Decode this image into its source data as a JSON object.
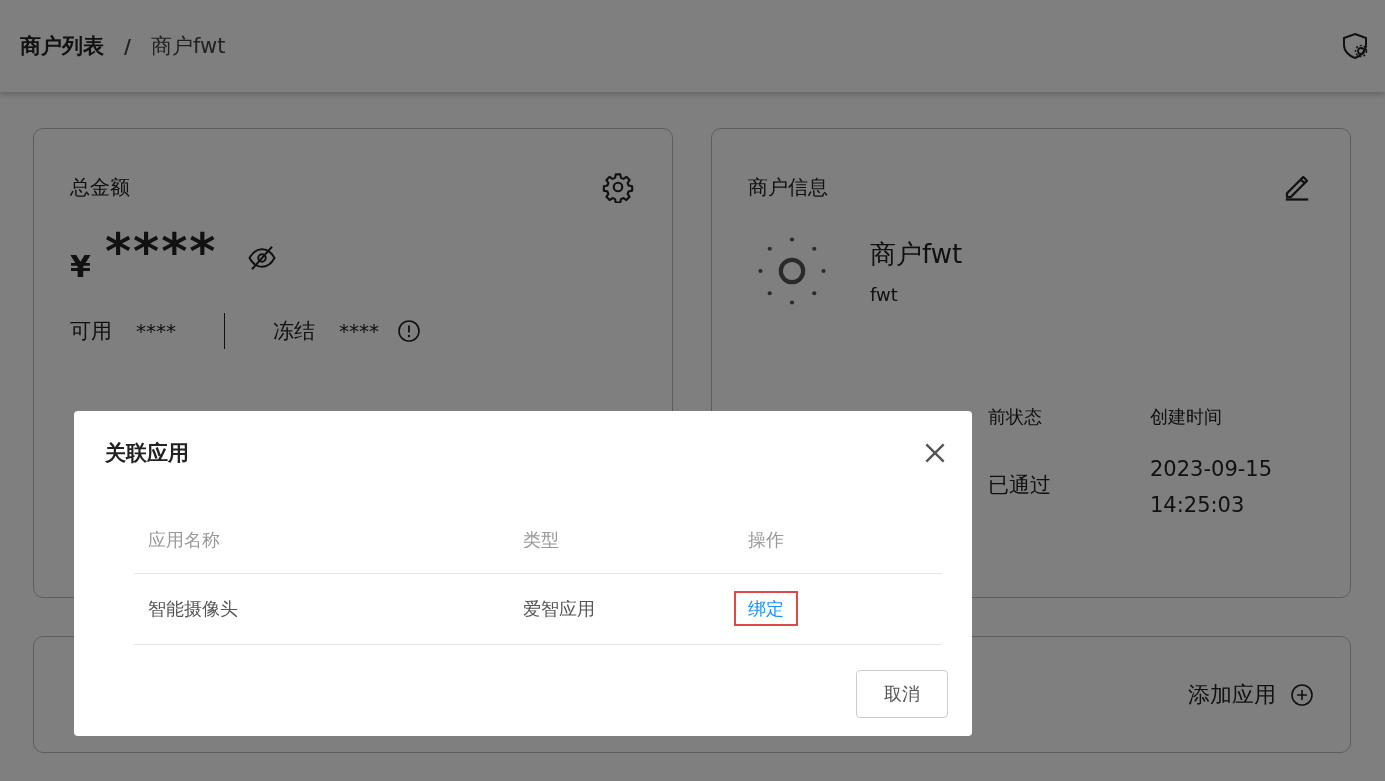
{
  "breadcrumb": {
    "items": [
      {
        "label": "商户列表",
        "current": false
      },
      {
        "label": "商户fwt",
        "current": true
      }
    ],
    "separator": "/"
  },
  "balance_card": {
    "title": "总金额",
    "currency": "¥",
    "amount": "****",
    "stats": [
      {
        "label": "可用",
        "value": "****"
      },
      {
        "label": "冻结",
        "value": "****",
        "info": true
      }
    ]
  },
  "merchant_card": {
    "title": "商户信息",
    "name": "商户fwt",
    "code": "fwt",
    "fields": [
      {
        "label": "前状态",
        "value": "已通过"
      },
      {
        "label": "创建时间",
        "value": "2023-09-15 14:25:03"
      }
    ]
  },
  "apps_card": {
    "add_label": "添加应用"
  },
  "dialog": {
    "title": "关联应用",
    "columns": [
      "应用名称",
      "类型",
      "操作"
    ],
    "rows": [
      {
        "name": "智能摄像头",
        "type": "爱智应用",
        "action": "绑定",
        "highlighted": true
      }
    ],
    "buttons": [
      "取消"
    ]
  }
}
